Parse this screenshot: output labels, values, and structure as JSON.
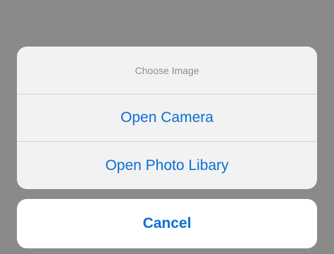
{
  "action_sheet": {
    "title": "Choose Image",
    "actions": [
      {
        "label": "Open Camera"
      },
      {
        "label": "Open Photo Libary"
      }
    ],
    "cancel_label": "Cancel"
  },
  "colors": {
    "backdrop": "#8a8a8a",
    "sheet_background": "#f2f2f2",
    "cancel_background": "#ffffff",
    "action_text": "#0a6fd6",
    "title_text": "#8e8e93",
    "separator": "#d1d1d6"
  }
}
